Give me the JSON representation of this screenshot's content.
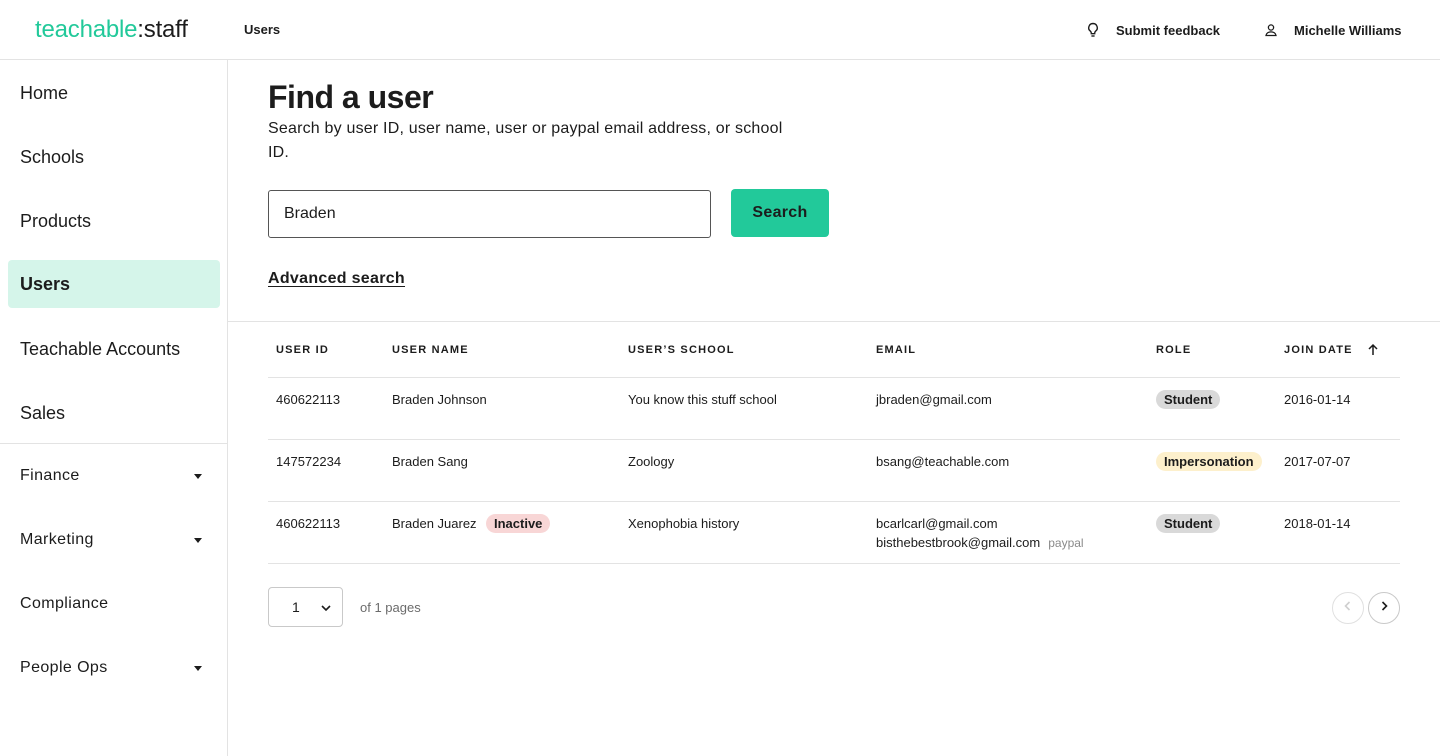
{
  "header": {
    "logo_brand": "teachable",
    "logo_sep": ":",
    "logo_suffix": "staff",
    "breadcrumb": "Users",
    "feedback_label": "Submit feedback",
    "user_name": "Michelle Williams"
  },
  "sidebar": {
    "items": [
      {
        "label": "Home"
      },
      {
        "label": "Schools"
      },
      {
        "label": "Products"
      },
      {
        "label": "Users"
      },
      {
        "label": "Teachable Accounts"
      },
      {
        "label": "Sales"
      }
    ],
    "active": "Users",
    "groups": [
      {
        "label": "Finance",
        "has_children": true
      },
      {
        "label": "Marketing",
        "has_children": true
      },
      {
        "label": "Compliance",
        "has_children": false
      },
      {
        "label": "People Ops",
        "has_children": true
      }
    ]
  },
  "main": {
    "title": "Find a user",
    "subtitle": "Search by user ID, user name, user or paypal email address, or school ID.",
    "search_value": "Braden",
    "search_button": "Search",
    "advanced_search": "Advanced search"
  },
  "table": {
    "columns": [
      "User ID",
      "User name",
      "User’s school",
      "Email",
      "Role",
      "Join date"
    ],
    "sort_column": "Join date",
    "sort_direction": "ascending",
    "rows": [
      {
        "id": "460622113",
        "name": "Braden Johnson",
        "school": "You know this stuff school",
        "email": "jbraden@gmail.com",
        "role": "Student",
        "join_date": "2016-01-14"
      },
      {
        "id": "147572234",
        "name": "Braden Sang",
        "school": "Zoology",
        "email": "bsang@teachable.com",
        "role": "Impersonation",
        "join_date": "2017-07-07"
      },
      {
        "id": "460622113",
        "name": "Braden Juarez",
        "status": "Inactive",
        "school": "Xenophobia history",
        "email": "bcarlcarl@gmail.com",
        "paypal_email": "bisthebestbrook@gmail.com",
        "paypal_tag": "paypal",
        "role": "Student",
        "join_date": "2018-01-14"
      }
    ]
  },
  "pagination": {
    "current_page": "1",
    "of_label": "of 1 pages"
  },
  "colors": {
    "accent": "#22c99a",
    "active_nav_bg": "#d5f5ea",
    "badge_student": "#d9d9d9",
    "badge_impersonation": "#fdf0cc",
    "badge_inactive": "#f8d6d6"
  },
  "icons": {
    "feedback": "lightbulb-icon",
    "user": "user-icon",
    "sort": "arrow-up-icon",
    "dropdown": "caret-down-icon",
    "prev": "chevron-left-icon",
    "next": "chevron-right-icon"
  }
}
